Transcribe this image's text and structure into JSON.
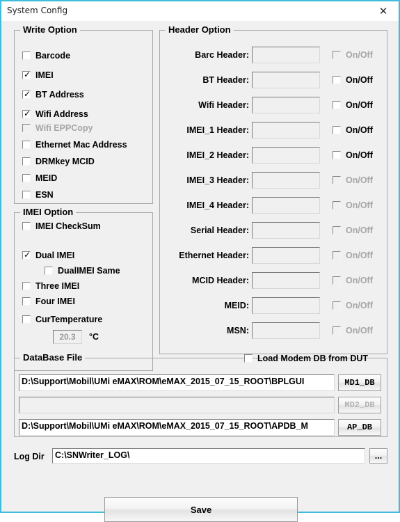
{
  "window": {
    "title": "System Config",
    "close_icon": "close-icon",
    "border_color": "#3FBCDC"
  },
  "write_option": {
    "legend": "Write Option",
    "items": [
      {
        "label": "Barcode",
        "checked": false,
        "enabled": true
      },
      {
        "label": "IMEI",
        "checked": true,
        "enabled": true
      },
      {
        "label": "BT Address",
        "checked": true,
        "enabled": true
      },
      {
        "label": "Wifi Address",
        "checked": true,
        "enabled": true
      },
      {
        "label": "Wifi EPPCopy",
        "checked": false,
        "enabled": false
      },
      {
        "label": "Ethernet Mac Address",
        "checked": false,
        "enabled": true
      },
      {
        "label": "DRMkey MCID",
        "checked": false,
        "enabled": true
      },
      {
        "label": "MEID",
        "checked": false,
        "enabled": true
      },
      {
        "label": "ESN",
        "checked": false,
        "enabled": true
      }
    ]
  },
  "imei_option": {
    "legend": "IMEI Option",
    "items": [
      {
        "label": "IMEI CheckSum",
        "checked": false,
        "enabled": true
      },
      {
        "label": "Dual IMEI",
        "checked": true,
        "enabled": true
      },
      {
        "label": "DualIMEI Same",
        "checked": false,
        "enabled": true
      },
      {
        "label": "Three IMEI",
        "checked": false,
        "enabled": true
      },
      {
        "label": "Four IMEI",
        "checked": false,
        "enabled": true
      },
      {
        "label": "CurTemperature",
        "checked": false,
        "enabled": true
      }
    ],
    "temperature": {
      "value": "20.3",
      "unit": "°C",
      "enabled": false
    }
  },
  "header_option": {
    "legend": "Header Option",
    "toggle_label": "On/Off",
    "rows": [
      {
        "label": "Barc Header:",
        "value": "",
        "checked": false,
        "enabled": false
      },
      {
        "label": "BT Header:",
        "value": "",
        "checked": false,
        "enabled": true
      },
      {
        "label": "Wifi Header:",
        "value": "",
        "checked": false,
        "enabled": true
      },
      {
        "label": "IMEI_1 Header:",
        "value": "",
        "checked": false,
        "enabled": true
      },
      {
        "label": "IMEI_2 Header:",
        "value": "",
        "checked": false,
        "enabled": true
      },
      {
        "label": "IMEI_3 Header:",
        "value": "",
        "checked": false,
        "enabled": false
      },
      {
        "label": "IMEI_4 Header:",
        "value": "",
        "checked": false,
        "enabled": false
      },
      {
        "label": "Serial Header:",
        "value": "",
        "checked": false,
        "enabled": false
      },
      {
        "label": "Ethernet Header:",
        "value": "",
        "checked": false,
        "enabled": false
      },
      {
        "label": "MCID Header:",
        "value": "",
        "checked": false,
        "enabled": false
      },
      {
        "label": "MEID:",
        "value": "",
        "checked": false,
        "enabled": false
      },
      {
        "label": "MSN:",
        "value": "",
        "checked": false,
        "enabled": false
      }
    ]
  },
  "database_file": {
    "legend": "DataBase File",
    "load_modem_label": "Load Modem DB from DUT",
    "load_modem_checked": false,
    "rows": [
      {
        "path": "D:\\Support\\Mobil\\UMi eMAX\\ROM\\eMAX_2015_07_15_ROOT\\BPLGUI",
        "button": "MD1_DB",
        "enabled": true
      },
      {
        "path": "",
        "button": "MD2_DB",
        "enabled": false
      },
      {
        "path": "D:\\Support\\Mobil\\UMi eMAX\\ROM\\eMAX_2015_07_15_ROOT\\APDB_M",
        "button": "AP_DB",
        "enabled": true
      }
    ]
  },
  "log_dir": {
    "label": "Log Dir",
    "value": "C:\\SNWriter_LOG\\",
    "browse_button": "..."
  },
  "save": {
    "label": "Save"
  }
}
